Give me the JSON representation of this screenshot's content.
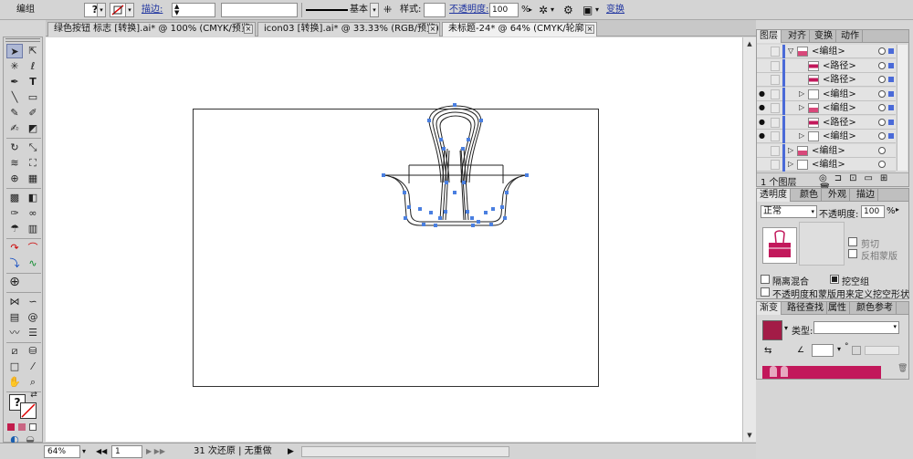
{
  "control_bar": {
    "selection_type": "编组",
    "stroke_label": "描边:",
    "stroke_profile": "基本",
    "style_label": "样式:",
    "opacity_label": "不透明度:",
    "opacity_value": "100",
    "opacity_unit": "%",
    "transform_label": "变换"
  },
  "doc_tabs": [
    {
      "label": "绿色按钮 标志 [转换].ai* @ 100% (CMYK/预览)",
      "active": false
    },
    {
      "label": "icon03 [转换].ai* @ 33.33% (RGB/预览)",
      "active": false
    },
    {
      "label": "未标题-24* @ 64% (CMYK/轮廓)",
      "active": true
    }
  ],
  "status_bar": {
    "zoom": "64%",
    "artboard_number": "1",
    "undo_status": "31 次还原 | 无重做"
  },
  "layers_panel": {
    "tabs": [
      "图层",
      "对齐",
      "变换",
      "动作"
    ],
    "rows": [
      {
        "name": "<编组>",
        "depth": 0,
        "visible": false,
        "expanded": true,
        "thumb": "clip-pink"
      },
      {
        "name": "<路径>",
        "depth": 1,
        "visible": false,
        "expanded": false,
        "thumb": "pink-bar"
      },
      {
        "name": "<路径>",
        "depth": 1,
        "visible": false,
        "expanded": false,
        "thumb": "pink-bar"
      },
      {
        "name": "<编组>",
        "depth": 1,
        "visible": true,
        "expanded": false,
        "thumb": "empty"
      },
      {
        "name": "<编组>",
        "depth": 1,
        "visible": true,
        "expanded": false,
        "thumb": "clip-small"
      },
      {
        "name": "<路径>",
        "depth": 1,
        "visible": true,
        "expanded": false,
        "thumb": "pink-bar"
      },
      {
        "name": "<编组>",
        "depth": 1,
        "visible": true,
        "expanded": false,
        "thumb": "empty"
      },
      {
        "name": "<编组>",
        "depth": 0,
        "visible": false,
        "expanded": false,
        "thumb": "clip-small"
      },
      {
        "name": "<编组>",
        "depth": 0,
        "visible": false,
        "expanded": false,
        "thumb": "empty"
      }
    ],
    "footer_count": "1 个图层"
  },
  "transparency_panel": {
    "tabs": [
      "透明度",
      "颜色",
      "外观",
      "描边"
    ],
    "blend_mode": "正常",
    "opacity_label": "不透明度:",
    "opacity_value": "100",
    "opacity_unit": "%",
    "clip_label": "剪切",
    "invert_mask_label": "反相蒙版",
    "isolate_blending_label": "隔离混合",
    "knockout_group_label": "挖空组",
    "opacity_mask_label": "不透明度和蒙版用来定义挖空形状"
  },
  "gradient_panel": {
    "tabs": [
      "渐变",
      "路径查找",
      "属性",
      "颜色参考"
    ],
    "type_label": "类型:",
    "swatch_color": "#a31c47",
    "gradient_bar_color": "#c2185b",
    "degree_unit": "°"
  },
  "colors": {
    "selection_blue": "#4a7fe0",
    "layer_blue": "#4a6ad8",
    "canvas_bg": "#ffffff",
    "ui_bg": "#d6d6d6"
  }
}
